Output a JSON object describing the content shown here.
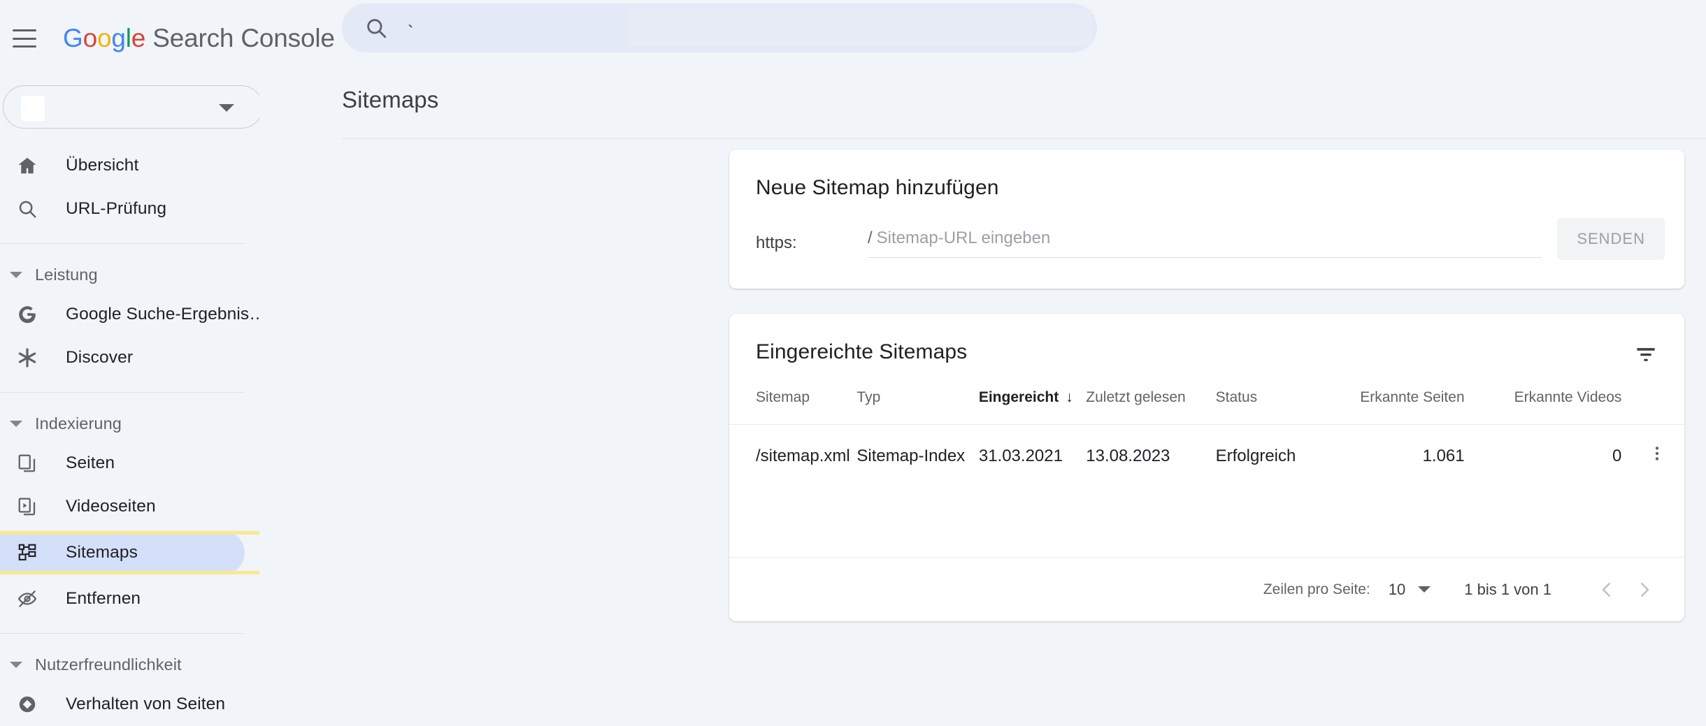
{
  "app": {
    "brand_google": "Google",
    "brand_rest": " Search Console",
    "menu_icon": "hamburger-icon"
  },
  "search": {
    "icon": "search-icon",
    "value": "`",
    "placeholder": ""
  },
  "sidebar": {
    "property_selector": {
      "value": "",
      "caret": "chevron-down-icon"
    },
    "items": [
      {
        "id": "uebersicht",
        "label": "Übersicht",
        "icon": "home-icon",
        "type": "item",
        "selected": false
      },
      {
        "id": "url-pruefung",
        "label": "URL-Prüfung",
        "icon": "search-icon",
        "type": "item",
        "selected": false
      },
      {
        "id": "div1",
        "label": "",
        "icon": "",
        "type": "divider",
        "selected": false
      },
      {
        "id": "leistung",
        "label": "Leistung",
        "icon": "chevron-down-icon",
        "type": "group",
        "selected": false
      },
      {
        "id": "google-suche",
        "label": "Google Suche-Ergebnis…",
        "icon": "google-g-icon",
        "type": "item",
        "selected": false
      },
      {
        "id": "discover",
        "label": "Discover",
        "icon": "asterisk-icon",
        "type": "item",
        "selected": false
      },
      {
        "id": "div2",
        "label": "",
        "icon": "",
        "type": "divider",
        "selected": false
      },
      {
        "id": "indexierung",
        "label": "Indexierung",
        "icon": "chevron-down-icon",
        "type": "group",
        "selected": false
      },
      {
        "id": "seiten",
        "label": "Seiten",
        "icon": "pages-icon",
        "type": "item",
        "selected": false
      },
      {
        "id": "videoseiten",
        "label": "Videoseiten",
        "icon": "video-pages-icon",
        "type": "item",
        "selected": false
      },
      {
        "id": "sitemaps",
        "label": "Sitemaps",
        "icon": "sitemap-icon",
        "type": "item",
        "selected": true
      },
      {
        "id": "entfernen",
        "label": "Entfernen",
        "icon": "eye-off-icon",
        "type": "item",
        "selected": false
      },
      {
        "id": "div3",
        "label": "",
        "icon": "",
        "type": "divider",
        "selected": false
      },
      {
        "id": "nutzerfr",
        "label": "Nutzerfreundlichkeit",
        "icon": "chevron-down-icon",
        "type": "group",
        "selected": false
      },
      {
        "id": "verhalten",
        "label": "Verhalten von Seiten",
        "icon": "page-experience-icon",
        "type": "item",
        "selected": false
      }
    ]
  },
  "page": {
    "title": "Sitemaps"
  },
  "add_sitemap_card": {
    "title": "Neue Sitemap hinzufügen",
    "scheme_label": "https:",
    "path_separator": "/",
    "input_placeholder": "Sitemap-URL eingeben",
    "input_value": "",
    "submit_label": "SENDEN"
  },
  "sitemaps_card": {
    "title": "Eingereichte Sitemaps",
    "filter_icon": "filter-icon",
    "columns": [
      {
        "key": "sitemap",
        "label": "Sitemap",
        "sorted": false,
        "align": "left"
      },
      {
        "key": "typ",
        "label": "Typ",
        "sorted": false,
        "align": "left"
      },
      {
        "key": "eing",
        "label": "Eingereicht",
        "sorted": true,
        "align": "left",
        "sort_dir": "↓"
      },
      {
        "key": "zul",
        "label": "Zuletzt gelesen",
        "sorted": false,
        "align": "left"
      },
      {
        "key": "status",
        "label": "Status",
        "sorted": false,
        "align": "left"
      },
      {
        "key": "seiten",
        "label": "Erkannte Seiten",
        "sorted": false,
        "align": "right"
      },
      {
        "key": "videos",
        "label": "Erkannte Videos",
        "sorted": false,
        "align": "right"
      }
    ],
    "rows": [
      {
        "sitemap": "/sitemap.xml",
        "typ": "Sitemap-Index",
        "eing": "31.03.2021",
        "zul": "13.08.2023",
        "status": "Erfolgreich",
        "seiten": "1.061",
        "videos": "0",
        "menu_icon": "kebab-menu-icon"
      }
    ],
    "pagination": {
      "rows_per_page_label": "Zeilen pro Seite:",
      "rows_per_page_value": "10",
      "range_label": "1 bis 1 von 1",
      "prev_icon": "chevron-left-icon",
      "next_icon": "chevron-right-icon"
    }
  },
  "colors": {
    "page_background": "#f1f4f9",
    "card_background": "#ffffff",
    "accent_blue": "#4285F4",
    "status_success": "#188038",
    "selected_nav_background": "#d4e0fa",
    "highlight_border": "#f7e98e",
    "search_background": "#e3e9f6"
  }
}
